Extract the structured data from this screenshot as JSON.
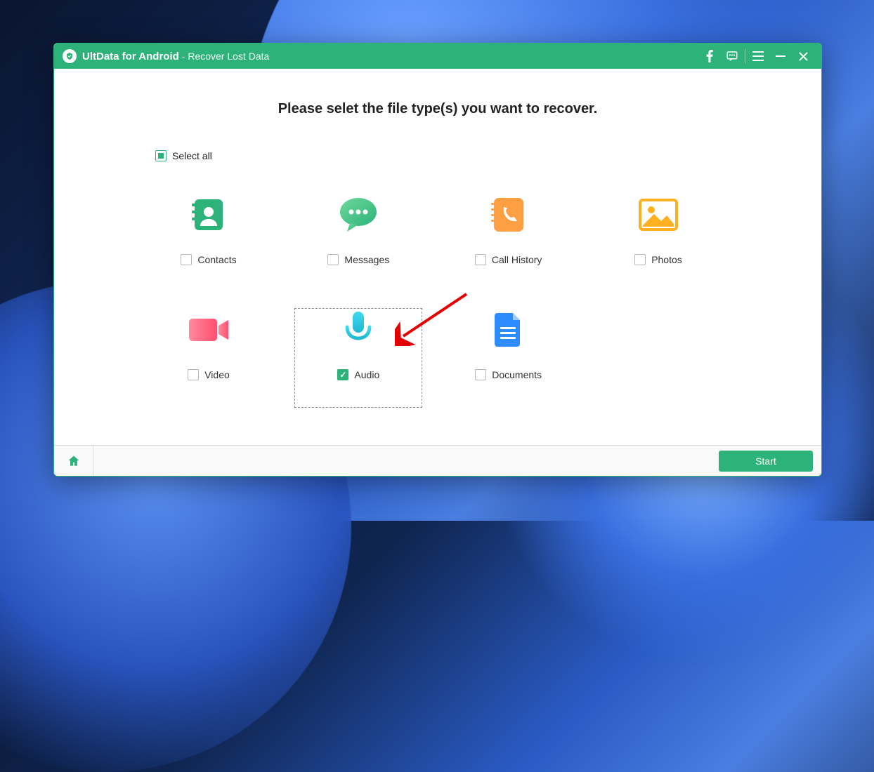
{
  "titlebar": {
    "app_name": "UltData for Android",
    "subtitle": "- Recover Lost Data"
  },
  "heading": "Please selet the file type(s) you want to recover.",
  "select_all_label": "Select all",
  "tiles": {
    "contacts": "Contacts",
    "messages": "Messages",
    "call_history": "Call History",
    "photos": "Photos",
    "video": "Video",
    "audio": "Audio",
    "documents": "Documents"
  },
  "footer": {
    "start_label": "Start"
  }
}
